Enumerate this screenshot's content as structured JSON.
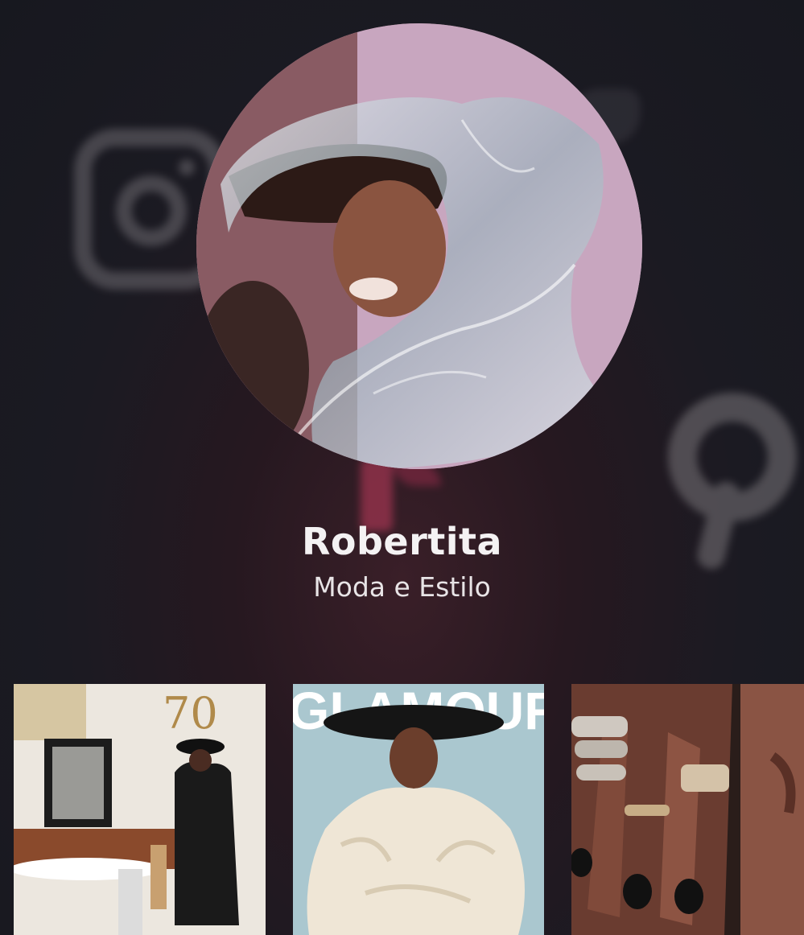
{
  "profile": {
    "name": "Robertita",
    "subtitle": "Moda e Estilo",
    "avatar_icon": "profile-photo"
  },
  "background_icons": [
    "instagram-icon",
    "tiktok-icon",
    "pinterest-icon",
    "twitter-icon"
  ],
  "gallery": [
    {
      "name": "magazine-cover-70",
      "cover_text": "70"
    },
    {
      "name": "magazine-cover-glamour",
      "cover_text": "GLAMOUR"
    },
    {
      "name": "rings-photo"
    }
  ],
  "colors": {
    "background": "#1b1a22",
    "accent": "#3a1f28",
    "text": "#f4f2f3"
  }
}
